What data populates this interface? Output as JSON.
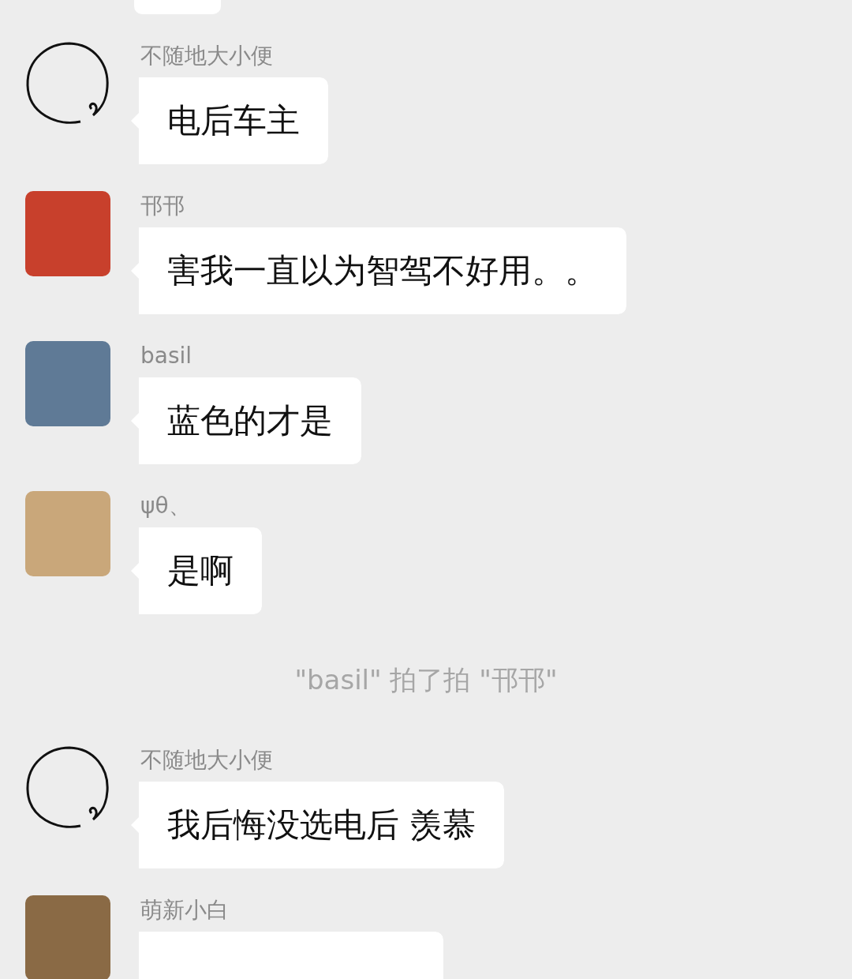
{
  "messages": [
    {
      "kind": "message",
      "sender": "不随地大小便",
      "avatar": {
        "kind": "drawn-circle"
      },
      "text": "电后车主"
    },
    {
      "kind": "message",
      "sender": "邗邗",
      "avatar": {
        "kind": "picture",
        "color": "#c8402c"
      },
      "text": "害我一直以为智驾不好用。。"
    },
    {
      "kind": "message",
      "sender": "basil",
      "avatar": {
        "kind": "picture",
        "color": "#5f7a96"
      },
      "text": "蓝色的才是"
    },
    {
      "kind": "message",
      "sender": "ψθ、",
      "avatar": {
        "kind": "picture",
        "color": "#c9a77a"
      },
      "text": "是啊"
    },
    {
      "kind": "system",
      "text": "\"basil\" 拍了拍 \"邗邗\""
    },
    {
      "kind": "message",
      "sender": "不随地大小便",
      "avatar": {
        "kind": "drawn-circle"
      },
      "text": "我后悔没选电后 羡慕"
    },
    {
      "kind": "message",
      "sender": "萌新小白",
      "avatar": {
        "kind": "picture",
        "color": "#8a6a45"
      }
    }
  ]
}
